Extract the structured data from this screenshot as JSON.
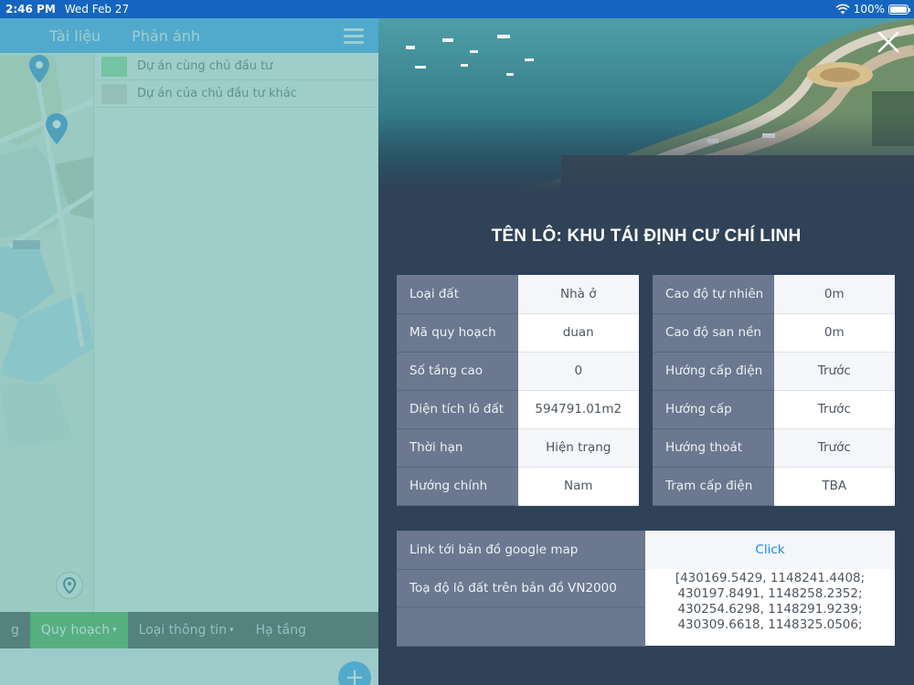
{
  "status_bar": {
    "time": "2:46 PM",
    "date": "Wed Feb 27",
    "battery": "100%",
    "battery_level": 1.0
  },
  "nav": {
    "tabs": [
      "Tài liệu",
      "Phản ánh"
    ]
  },
  "legend": [
    {
      "label": "Dự án cùng chủ đầu tư",
      "color": "#8fdc9a"
    },
    {
      "label": "Dự án của chủ đầu tư khác",
      "color": "#d8d6c8"
    }
  ],
  "bottom_tabs": [
    {
      "label": "g"
    },
    {
      "label": "Quy hoạch",
      "active": true,
      "caret": "▾"
    },
    {
      "label": "Loại thông tin",
      "caret": "▾"
    },
    {
      "label": "Hạ tầng"
    }
  ],
  "detail": {
    "title": "TÊN LÔ: KHU TÁI ĐỊNH CƯ CHÍ LINH",
    "left_table": [
      {
        "label": "Loại đất",
        "value": "Nhà ở"
      },
      {
        "label": "Mã quy hoạch",
        "value": "duan"
      },
      {
        "label": "Số tầng cao",
        "value": "0"
      },
      {
        "label": "Diện tích lô đất",
        "value": "594791.01m2"
      },
      {
        "label": "Thời hạn",
        "value": "Hiện trạng"
      },
      {
        "label": "Hướng chính",
        "value": "Nam"
      }
    ],
    "right_table": [
      {
        "label": "Cao độ tự nhiên",
        "value": "0m"
      },
      {
        "label": "Cao độ san nền",
        "value": "0m"
      },
      {
        "label": "Hướng cấp điện",
        "value": "Trước"
      },
      {
        "label": "Hướng cấp",
        "value": "Trước"
      },
      {
        "label": "Hướng thoát",
        "value": "Trước"
      },
      {
        "label": "Trạm cấp điện",
        "value": "TBA"
      }
    ],
    "map_link": {
      "label": "Link tới bản đồ google map",
      "value": "Click"
    },
    "coords": {
      "label": "Toạ độ lô đất trên bản đồ VN2000",
      "lines": [
        "[430169.5429, 1148241.4408;",
        "430197.8491, 1148258.2352;",
        "430254.6298, 1148291.9239;",
        "430309.6618, 1148325.0506;"
      ]
    }
  },
  "colors": {
    "status_bar": "#1565c0",
    "panel_bg": "#2f4257",
    "key_cell": "#6b7890",
    "link": "#1e88e5",
    "active_tab": "#4caf50"
  }
}
